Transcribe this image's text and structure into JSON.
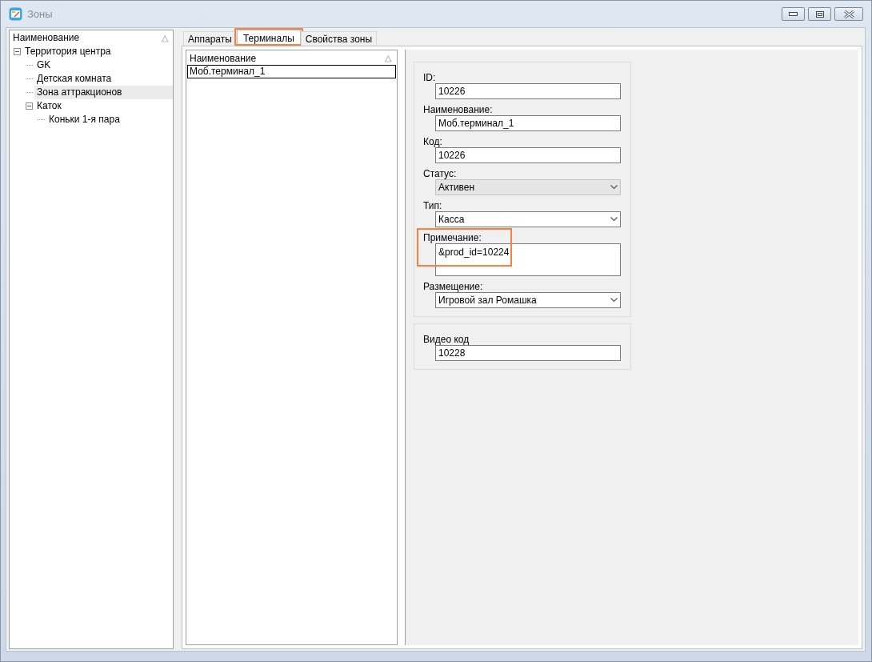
{
  "window": {
    "title": "Зоны"
  },
  "tree": {
    "header": "Наименование",
    "sort_glyph": "△",
    "items": [
      {
        "label": "Территория центра",
        "expanded": true,
        "selected": false,
        "children": [
          {
            "label": "GK",
            "selected": false
          },
          {
            "label": "Детская комната",
            "selected": false
          },
          {
            "label": "Зона аттракционов",
            "selected": true
          },
          {
            "label": "Каток",
            "expanded": true,
            "selected": false,
            "children": [
              {
                "label": "Коньки 1-я пара",
                "selected": false
              }
            ]
          }
        ]
      }
    ]
  },
  "tabs": [
    {
      "label": "Аппараты",
      "selected": false,
      "highlighted": false
    },
    {
      "label": "Терминалы",
      "selected": true,
      "highlighted": true
    },
    {
      "label": "Свойства зоны",
      "selected": false,
      "highlighted": false
    }
  ],
  "terminal_list": {
    "header": "Наименование",
    "sort_glyph": "△",
    "rows": [
      {
        "label": "Моб.терминал_1",
        "selected": true
      }
    ]
  },
  "form_groups": [
    {
      "fields": [
        {
          "kind": "text",
          "label": "ID:",
          "value": "10226",
          "disabled": false,
          "highlighted": false
        },
        {
          "kind": "text",
          "label": "Наименование:",
          "value": "Моб.терминал_1",
          "disabled": false,
          "highlighted": false
        },
        {
          "kind": "text",
          "label": "Код:",
          "value": "10226",
          "disabled": false,
          "highlighted": false
        },
        {
          "kind": "select",
          "label": "Статус:",
          "value": "Активен",
          "disabled": true,
          "highlighted": false
        },
        {
          "kind": "select",
          "label": "Тип:",
          "value": "Касса",
          "disabled": false,
          "highlighted": false
        },
        {
          "kind": "memo",
          "label": "Примечание:",
          "value": "&prod_id=10224",
          "disabled": false,
          "highlighted": true
        },
        {
          "kind": "select",
          "label": "Размещение:",
          "value": "Игровой зал Ромашка",
          "disabled": false,
          "highlighted": false
        }
      ]
    },
    {
      "fields": [
        {
          "kind": "text",
          "label": "Видео код",
          "value": "10228",
          "disabled": false,
          "highlighted": false
        }
      ]
    }
  ]
}
